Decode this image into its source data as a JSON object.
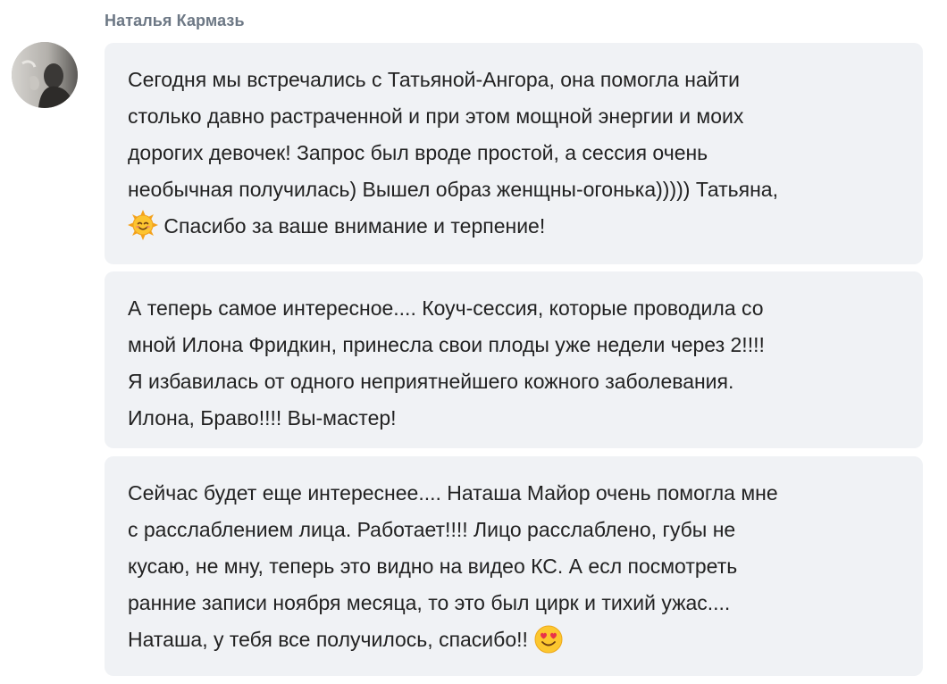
{
  "message": {
    "author": "Наталья Кармазь",
    "bubbles": [
      {
        "lines": [
          "Сегодня мы встречались с Татьяной-Ангора, она помогла найти",
          "столько давно растраченной и при этом мощной энергии и моих",
          "дорогих девочек! Запрос был вроде простой, а сессия очень",
          "необычная получилась) Вышел образ женщны-огонька))))) Татьяна,",
          "Спасибо за ваше внимание и терпение!"
        ],
        "emoji": "sun-smile-emoji"
      },
      {
        "lines": [
          "А теперь самое интересное.... Коуч-сессия, которые проводила со",
          "мной Илона Фридкин, принесла свои плоды уже недели через 2!!!!",
          "Я избавилась от одного неприятнейшего кожного заболевания.",
          "Илона, Браво!!!! Вы-мастер!"
        ]
      },
      {
        "lines": [
          "Сейчас будет еще интереснее.... Наташа Майор очень помогла мне",
          "с расслаблением лица. Работает!!!! Лицо расслаблено, губы не",
          "кусаю, не мну, теперь это видно на видео КС. А есл посмотреть",
          "ранние записи ноября месяца, то это был цирк и тихий ужас....",
          "Наташа, у тебя все получилось, спасибо!!"
        ],
        "emoji": "smiling-face-with-heart-eyes-emoji"
      }
    ]
  },
  "colors": {
    "author": "#6d7885",
    "bubble_bg": "#f0f2f5",
    "text": "#222222"
  }
}
